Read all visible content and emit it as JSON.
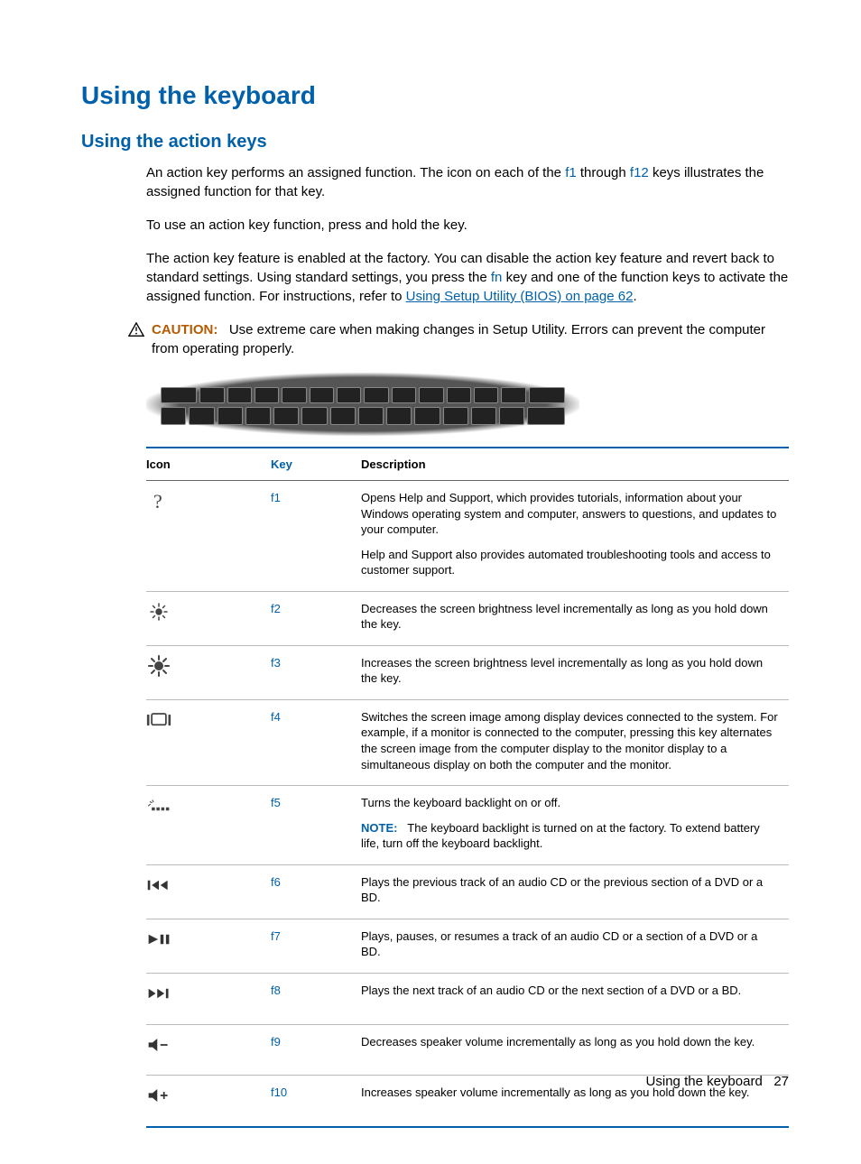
{
  "heading1": "Using the keyboard",
  "heading2": "Using the action keys",
  "intro": {
    "p1a": "An action key performs an assigned function. The icon on each of the ",
    "f1": "f1",
    "p1b": " through ",
    "f12": "f12",
    "p1c": " keys illustrates the assigned function for that key.",
    "p2": "To use an action key function, press and hold the key.",
    "p3a": "The action key feature is enabled at the factory. You can disable the action key feature and revert back to standard settings. Using standard settings, you press the ",
    "fn": "fn",
    "p3b": " key and one of the function keys to activate the assigned function. For instructions, refer to ",
    "link": "Using Setup Utility (BIOS) on page 62",
    "p3c": "."
  },
  "caution": {
    "label": "CAUTION:",
    "text": "Use extreme care when making changes in Setup Utility. Errors can prevent the computer from operating properly."
  },
  "table": {
    "headers": {
      "icon": "Icon",
      "key": "Key",
      "desc": "Description"
    },
    "rows": [
      {
        "icon": "help-icon",
        "key": "f1",
        "desc": [
          "Opens Help and Support, which provides tutorials, information about your Windows operating system and computer, answers to questions, and updates to your computer.",
          "Help and Support also provides automated troubleshooting tools and access to customer support."
        ]
      },
      {
        "icon": "brightness-down-icon",
        "key": "f2",
        "desc": [
          "Decreases the screen brightness level incrementally as long as you hold down the key."
        ]
      },
      {
        "icon": "brightness-up-icon",
        "key": "f3",
        "desc": [
          "Increases the screen brightness level incrementally as long as you hold down the key."
        ]
      },
      {
        "icon": "switch-display-icon",
        "key": "f4",
        "desc": [
          "Switches the screen image among display devices connected to the system. For example, if a monitor is connected to the computer, pressing this key alternates the screen image from the computer display to the monitor display to a simultaneous display on both the computer and the monitor."
        ]
      },
      {
        "icon": "backlight-icon",
        "key": "f5",
        "desc_plain": "Turns the keyboard backlight on or off.",
        "note_label": "NOTE:",
        "note_text": "The keyboard backlight is turned on at the factory. To extend battery life, turn off the keyboard backlight."
      },
      {
        "icon": "prev-track-icon",
        "key": "f6",
        "desc": [
          "Plays the previous track of an audio CD or the previous section of a DVD or a BD."
        ]
      },
      {
        "icon": "play-pause-icon",
        "key": "f7",
        "desc": [
          "Plays, pauses, or resumes a track of an audio CD or a section of a DVD or a BD."
        ]
      },
      {
        "icon": "next-track-icon",
        "key": "f8",
        "desc": [
          "Plays the next track of an audio CD or the next section of a DVD or a BD."
        ]
      },
      {
        "icon": "volume-down-icon",
        "key": "f9",
        "desc": [
          "Decreases speaker volume incrementally as long as you hold down the key."
        ]
      },
      {
        "icon": "volume-up-icon",
        "key": "f10",
        "desc": [
          "Increases speaker volume incrementally as long as you hold down the key."
        ]
      }
    ]
  },
  "footer": {
    "title": "Using the keyboard",
    "page": "27"
  }
}
